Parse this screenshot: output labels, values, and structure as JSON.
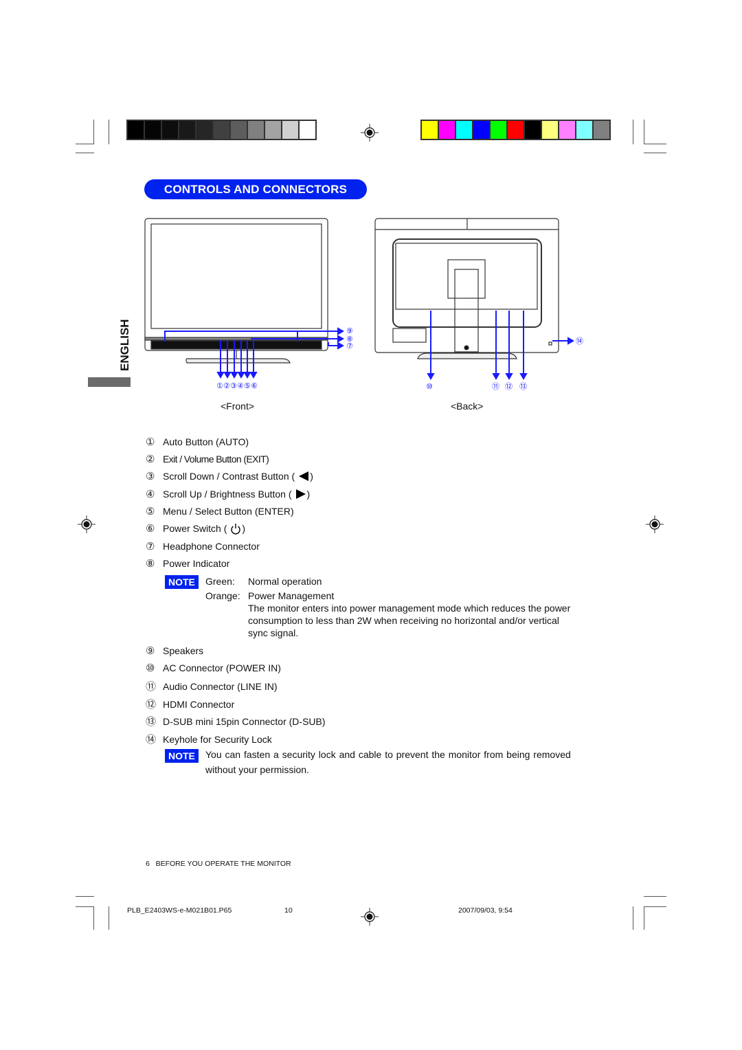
{
  "color_bar": {
    "grayscale": [
      "#000000",
      "#050505",
      "#0d0d0d",
      "#191919",
      "#262626",
      "#404040",
      "#5d5d5d",
      "#808080",
      "#a3a3a3",
      "#d0d0d0",
      "#ffffff"
    ],
    "colors": [
      "#ffff00",
      "#ff00ff",
      "#00ffff",
      "#0000ff",
      "#00ff00",
      "#ff0000",
      "#000000",
      "#ffff80",
      "#ff80ff",
      "#80ffff",
      "#808080"
    ]
  },
  "section_title": "CONTROLS AND CONNECTORS",
  "language_tab": "ENGLISH",
  "accent_color": "#0022ee",
  "diagram": {
    "front_caption": "<Front>",
    "back_caption": "<Back>",
    "front_callouts": [
      "①",
      "②",
      "③",
      "④",
      "⑤",
      "⑥",
      "⑦",
      "⑧",
      "⑨"
    ],
    "back_callouts": [
      "⑩",
      "⑪",
      "⑫",
      "⑬",
      "⑭"
    ]
  },
  "items": [
    {
      "num": "①",
      "label": "Auto Button (AUTO)"
    },
    {
      "num": "②",
      "label": "Exit / Volume Button (EXIT)"
    },
    {
      "num": "③",
      "label": "Scroll  Down / Contrast Button (",
      "icon": "left-triangle-icon",
      "suffix": " )"
    },
    {
      "num": "④",
      "label": "Scroll Up / Brightness Button (",
      "icon": "right-triangle-icon",
      "suffix": " )"
    },
    {
      "num": "⑤",
      "label": "Menu / Select Button (ENTER)"
    },
    {
      "num": "⑥",
      "label": "Power Switch (",
      "icon": "power-icon",
      "suffix": " )"
    },
    {
      "num": "⑦",
      "label": "Headphone Connector"
    },
    {
      "num": "⑧",
      "label": "Power Indicator"
    },
    {
      "num": "⑨",
      "label": "Speakers"
    },
    {
      "num": "⑩",
      "label": "AC Connector (POWER IN)"
    },
    {
      "num": "⑪",
      "label": "Audio Connector (LINE IN)"
    },
    {
      "num": "⑫",
      "label": "HDMI Connector"
    },
    {
      "num": "⑬",
      "label": "D-SUB mini 15pin Connector (D-SUB)"
    },
    {
      "num": "⑭",
      "label": "Keyhole for Security Lock"
    }
  ],
  "note1": {
    "badge": "NOTE",
    "green_label": "Green:",
    "green_text": "Normal operation",
    "orange_label": "Orange:",
    "orange_text": "Power Management",
    "detail_lines": [
      "The monitor enters into power management mode which reduces the power",
      "consumption to less than 2W when receiving no horizontal and/or vertical",
      "sync signal."
    ]
  },
  "note2": {
    "badge": "NOTE",
    "lines": [
      "You can fasten a security lock and cable to prevent the monitor from being removed",
      "without your permission."
    ]
  },
  "page_footer": "6   BEFORE YOU OPERATE THE MONITOR",
  "print_footer": {
    "file": "PLB_E2403WS-e-M021B01.P65",
    "page": "10",
    "datetime": "2007/09/03, 9:54"
  }
}
